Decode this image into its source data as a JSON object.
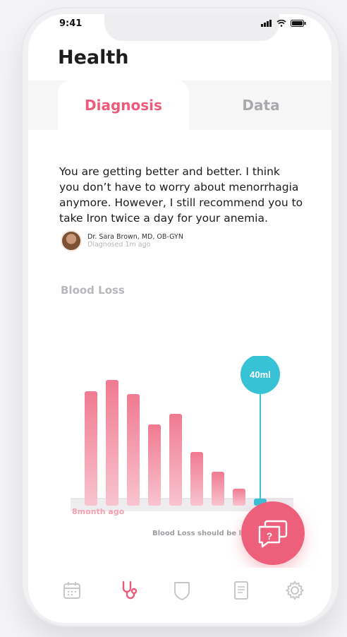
{
  "status": {
    "time": "9:41"
  },
  "header": {
    "title": "Health"
  },
  "tabs": [
    {
      "label": "Diagnosis",
      "active": true
    },
    {
      "label": "Data",
      "active": false
    }
  ],
  "diagnosis": {
    "text": "You are getting better and better. I think you don’t have to worry about menorrhagia anymore. However, I still recommend you to take Iron twice a day for your anemia.",
    "doctor_name": "Dr. Sara Brown, MD, OB-GYN",
    "diagnosed_time": "Diagnosed 1m ago"
  },
  "section": {
    "title": "Blood Loss"
  },
  "chart_data": {
    "type": "bar",
    "title": "Blood Loss",
    "values": [
      162,
      178,
      158,
      115,
      130,
      76,
      48,
      24,
      10
    ],
    "highlight_index": 8,
    "highlight_label": "40ml",
    "x_label_start": "8month ago",
    "colors": {
      "bar_top": "#f07a92",
      "bar_bottom": "#f8c4cf",
      "highlight": "#37c2d6"
    }
  },
  "note": "Blood Loss should be le",
  "fab": {
    "icon": "chat-question-icon"
  },
  "nav": [
    {
      "icon": "calendar-icon",
      "active": false
    },
    {
      "icon": "stethoscope-icon",
      "active": true
    },
    {
      "icon": "shield-icon",
      "active": false
    },
    {
      "icon": "document-icon",
      "active": false
    },
    {
      "icon": "gear-icon",
      "active": false
    }
  ],
  "colors": {
    "accent": "#ee5b79",
    "teal": "#37c2d6",
    "inactive": "#a9a9ad"
  }
}
